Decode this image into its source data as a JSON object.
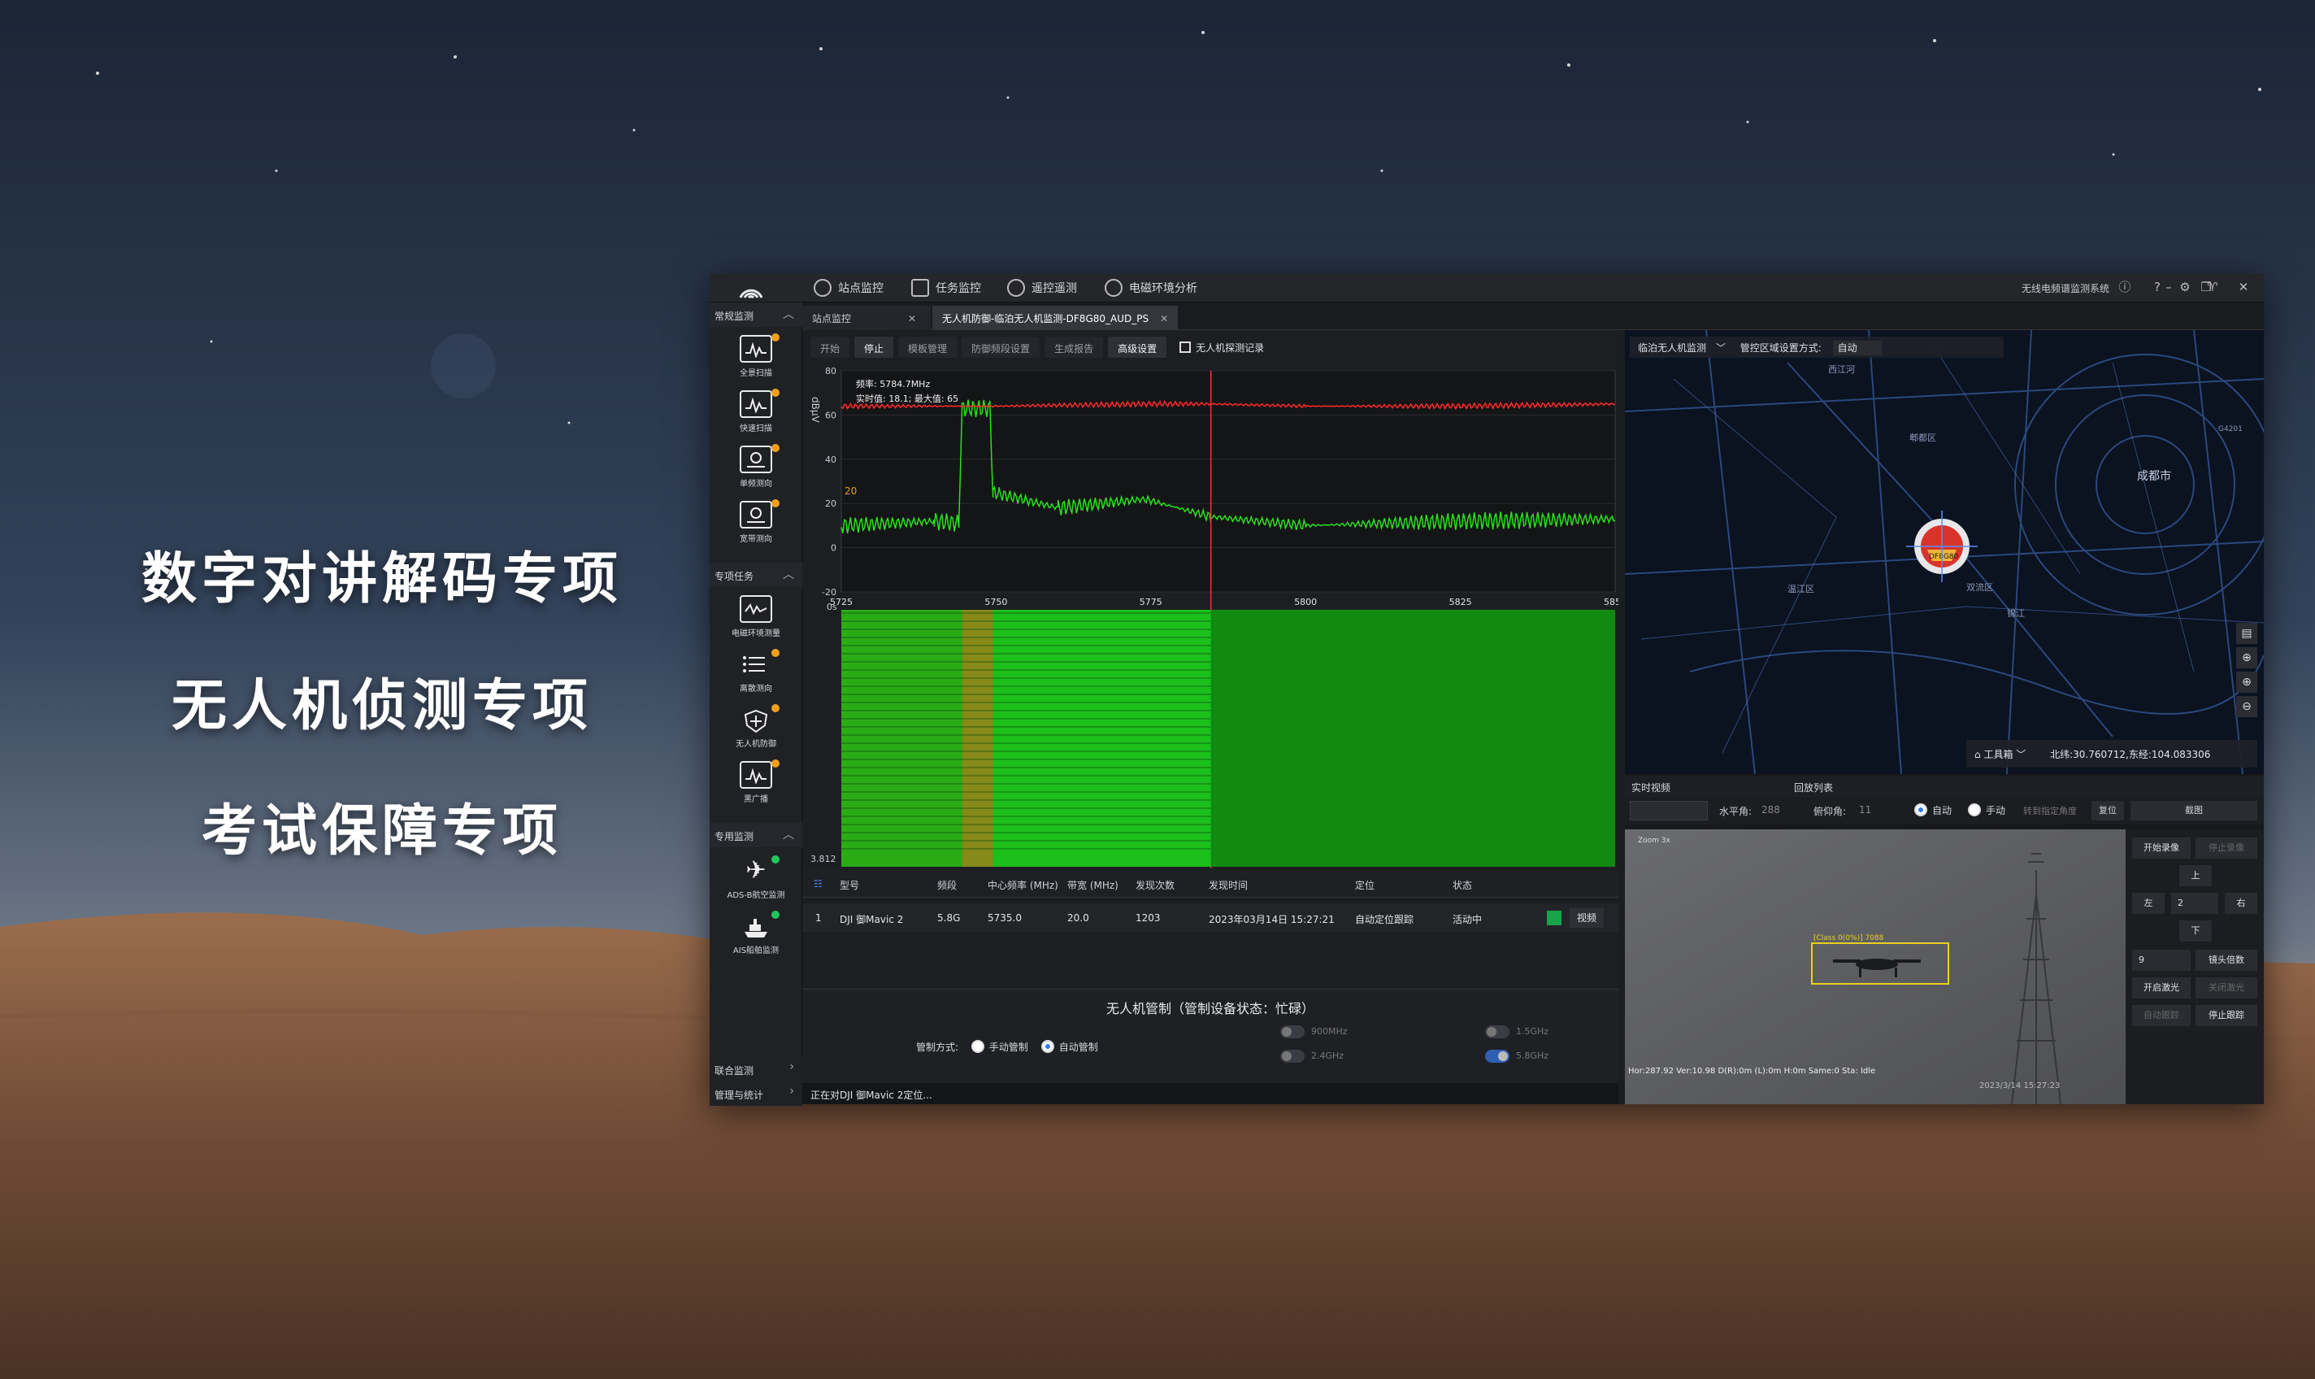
{
  "promo": {
    "line1": "数字对讲解码专项",
    "line2": "无人机侦测专项",
    "line3": "考试保障专项"
  },
  "app": {
    "nav": [
      "站点监控",
      "任务监控",
      "遥控遥测",
      "电磁环境分析"
    ],
    "system_name": "无线电频谱监测系统",
    "sidebar": {
      "section_common": "常规监测",
      "items_common": [
        "全景扫描",
        "快速扫描",
        "单频测向",
        "宽带测向"
      ],
      "section_special": "专项任务",
      "items_special": [
        "电磁环境测量",
        "离散测向",
        "无人机防御",
        "黑广播"
      ],
      "section_dedicated": "专用监测",
      "items_dedicated": [
        "ADS-B航空监测",
        "AIS船舶监测"
      ],
      "joint": "联合监测",
      "mgmt": "管理与统计"
    },
    "tabs": [
      "站点监控",
      "无人机防御-临泊无人机监测-DF8G80_AUD_PS"
    ],
    "toolbar": [
      "开始",
      "停止",
      "模板管理",
      "防御频段设置",
      "生成报告",
      "高级设置"
    ],
    "record_label": "无人机探测记录",
    "spectrum": {
      "y_unit": "dBμV",
      "y_ticks": [
        "80",
        "60",
        "40",
        "20",
        "0",
        "-20"
      ],
      "x_ticks": [
        "5725",
        "5750",
        "5775",
        "5800",
        "5825",
        "5850"
      ],
      "cursor_freq": "频率:  5784.7MHz",
      "cursor_vals": "实时值:  18.1;  最大值:   65",
      "marker": "20",
      "wf_top": "0s",
      "wf_bottom": "3.812"
    },
    "chart_data": {
      "type": "line",
      "xlabel": "",
      "ylabel": "dBμV",
      "xlim": [
        5725,
        5850
      ],
      "ylim": [
        -20,
        80
      ],
      "series": [
        {
          "x": [
            5725,
            5740,
            5744,
            5744.5,
            5749,
            5749.5,
            5760,
            5774,
            5784.7,
            5800,
            5825,
            5850
          ],
          "values": [
            10,
            12,
            11,
            63,
            63,
            25,
            18,
            22,
            14,
            10,
            12,
            13
          ]
        },
        {
          "x": [
            5725,
            5750,
            5775,
            5784.7,
            5800,
            5825,
            5850
          ],
          "values": [
            64,
            64,
            65,
            65,
            64,
            64,
            65
          ]
        }
      ]
    },
    "table": {
      "headers": [
        "型号",
        "频段",
        "中心频率 (MHz)",
        "带宽 (MHz)",
        "发现次数",
        "发现时间",
        "定位",
        "状态"
      ],
      "rows": [
        {
          "no": "1",
          "model": "DJI 御Mavic 2",
          "band": "5.8G",
          "center": "5735.0",
          "bw": "20.0",
          "count": "1203",
          "time": "2023年03月14日 15:27:21",
          "locate": "自动定位跟踪",
          "state": "活动中",
          "btn": "视频"
        }
      ]
    },
    "control": {
      "title": "无人机管制（管制设备状态：忙碌）",
      "mode_label": "管制方式:",
      "manual": "手动管制",
      "auto": "自动管制",
      "freqs": [
        "900MHz",
        "1.5GHz",
        "2.4GHz",
        "5.8GHz"
      ]
    },
    "status_bar": "正在对DJI 御Mavic 2定位...",
    "map": {
      "layer_select": "临泊无人机监测",
      "region_label": "管控区域设置方式:",
      "region_value": "自动",
      "city": "成都市",
      "places": [
        "西江河",
        "郫都区",
        "双流区",
        "温江区",
        "G4201",
        "锦江"
      ],
      "toolbox": "工具箱",
      "coords": "北纬:30.760712,东经:104.083306",
      "marker_label": "DF8G80"
    },
    "video_tabs": [
      "实时视频",
      "回放列表"
    ],
    "video_ctl": {
      "horiz_label": "水平角:",
      "horiz_val": "288",
      "pitch_label": "俯仰角:",
      "pitch_val": "11",
      "auto": "自动",
      "manual": "手动",
      "goto": "转到指定角度",
      "reset": "复位",
      "snapshot": "截图"
    },
    "video": {
      "top_text": "Zoom 3x",
      "box_label": "[Class 0(0%)] 7088",
      "osd": "Hor:287.92 Ver:10.98 D(R):0m (L):0m H:0m Same:0 Sta: Idle",
      "stamp": "2023/3/14 15:27:23"
    },
    "ptz": {
      "rec_start": "开始录像",
      "rec_stop": "停止录像",
      "up": "上",
      "left": "左",
      "step": "2",
      "right": "右",
      "down": "下",
      "zoom": "9",
      "lens": "镜头倍数",
      "laser_on": "开启激光",
      "laser_off": "关闭激光",
      "auto_track": "自动跟踪",
      "stop_track": "停止跟踪"
    }
  }
}
